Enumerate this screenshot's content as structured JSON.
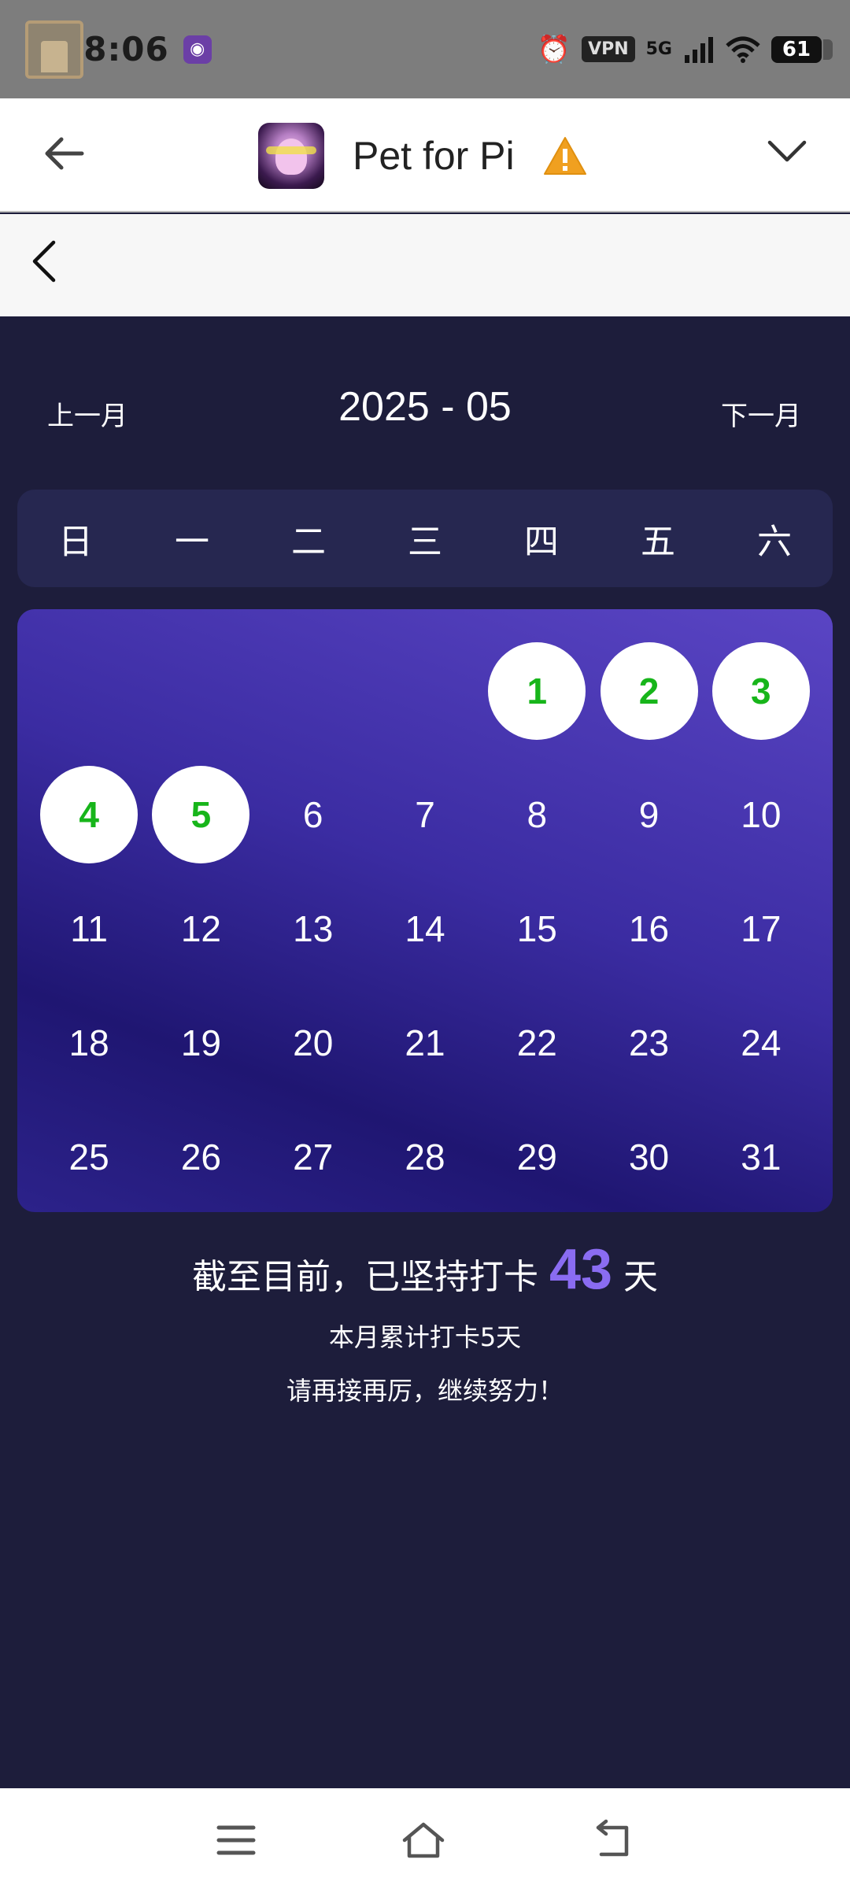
{
  "status_bar": {
    "time": "08:06",
    "vpn_label": "VPN",
    "network_label": "5G",
    "battery_level": "61"
  },
  "header": {
    "app_name": "Pet for Pi"
  },
  "calendar": {
    "prev_label": "上一月",
    "next_label": "下一月",
    "month_title": "2025 - 05",
    "weekdays": [
      "日",
      "一",
      "二",
      "三",
      "四",
      "五",
      "六"
    ],
    "weeks": [
      [
        null,
        null,
        null,
        null,
        {
          "day": "1",
          "checked": true
        },
        {
          "day": "2",
          "checked": true
        },
        {
          "day": "3",
          "checked": true
        }
      ],
      [
        {
          "day": "4",
          "checked": true
        },
        {
          "day": "5",
          "checked": true
        },
        {
          "day": "6"
        },
        {
          "day": "7"
        },
        {
          "day": "8"
        },
        {
          "day": "9"
        },
        {
          "day": "10"
        }
      ],
      [
        {
          "day": "11"
        },
        {
          "day": "12"
        },
        {
          "day": "13"
        },
        {
          "day": "14"
        },
        {
          "day": "15"
        },
        {
          "day": "16"
        },
        {
          "day": "17"
        }
      ],
      [
        {
          "day": "18"
        },
        {
          "day": "19"
        },
        {
          "day": "20"
        },
        {
          "day": "21"
        },
        {
          "day": "22"
        },
        {
          "day": "23"
        },
        {
          "day": "24"
        }
      ],
      [
        {
          "day": "25"
        },
        {
          "day": "26"
        },
        {
          "day": "27"
        },
        {
          "day": "28"
        },
        {
          "day": "29"
        },
        {
          "day": "30"
        },
        {
          "day": "31"
        }
      ]
    ]
  },
  "summary": {
    "prefix": "截至目前，已坚持打卡",
    "streak_days": "43",
    "suffix": "天",
    "monthly": "本月累计打卡5天",
    "encourage": "请再接再厉，继续努力！"
  },
  "colors": {
    "checked_text": "#17b51a",
    "streak_accent": "#8a6cf2",
    "page_bg": "#1d1d3b"
  }
}
